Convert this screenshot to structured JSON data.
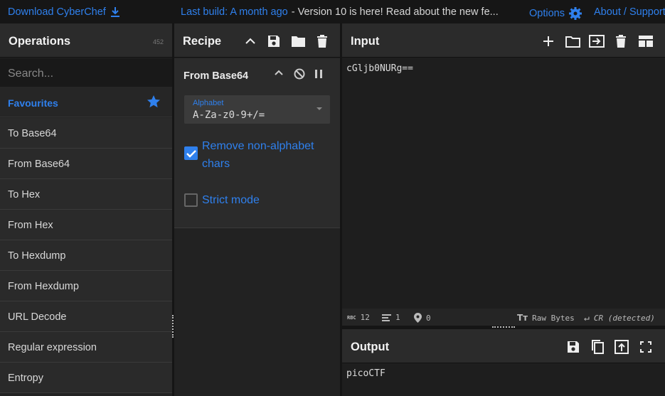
{
  "topbar": {
    "download": "Download CyberChef",
    "last_build": "Last build: A month ago",
    "version_notice": " - Version 10 is here! Read about the new fe...",
    "options": "Options",
    "about": "About / Support"
  },
  "operations": {
    "title": "Operations",
    "count": "452",
    "search_placeholder": "Search...",
    "favourites_label": "Favourites",
    "items": [
      "To Base64",
      "From Base64",
      "To Hex",
      "From Hex",
      "To Hexdump",
      "From Hexdump",
      "URL Decode",
      "Regular expression",
      "Entropy"
    ]
  },
  "recipe": {
    "title": "Recipe",
    "operation": {
      "name": "From Base64",
      "alphabet_label": "Alphabet",
      "alphabet_value": "A-Za-z0-9+/=",
      "remove_non_alphabet_label": "Remove non-alphabet chars",
      "remove_non_alphabet_checked": true,
      "strict_mode_label": "Strict mode",
      "strict_mode_checked": false
    }
  },
  "input": {
    "title": "Input",
    "value": "cGljb0NURg==",
    "status": {
      "length": "12",
      "lines": "1",
      "position": "0",
      "encoding": "Raw Bytes",
      "eol": "CR (detected)"
    }
  },
  "output": {
    "title": "Output",
    "value": "picoCTF"
  },
  "colors": {
    "accent": "#2f80ed",
    "background": "#1e1e1e",
    "panel_header": "#2b2b2b"
  }
}
